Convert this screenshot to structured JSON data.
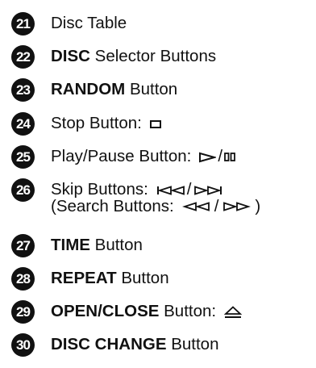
{
  "items": [
    {
      "number": "21",
      "text": "Disc Table"
    },
    {
      "number": "22",
      "bold": "DISC",
      "text": " Selector Buttons"
    },
    {
      "number": "23",
      "bold": "RANDOM",
      "text": " Button"
    },
    {
      "number": "24",
      "text": "Stop Button:",
      "symbols": [
        "stop-icon"
      ]
    },
    {
      "number": "25",
      "text": "Play/Pause Button:",
      "symbols": [
        "play-icon",
        "pause-icon"
      ]
    },
    {
      "number": "26",
      "text": "Skip Buttons:",
      "symbols": [
        "skip-back-icon",
        "skip-forward-icon"
      ],
      "subline": {
        "open": "(Search Buttons:",
        "close": ")",
        "symbols": [
          "search-back-icon",
          "search-forward-icon"
        ]
      }
    },
    {
      "number": "27",
      "bold": "TIME",
      "text": " Button"
    },
    {
      "number": "28",
      "bold": "REPEAT",
      "text": " Button"
    },
    {
      "number": "29",
      "bold": "OPEN/CLOSE",
      "text": " Button:",
      "symbols": [
        "eject-icon"
      ]
    },
    {
      "number": "30",
      "bold": "DISC CHANGE",
      "text": " Button"
    }
  ],
  "slash": "/"
}
